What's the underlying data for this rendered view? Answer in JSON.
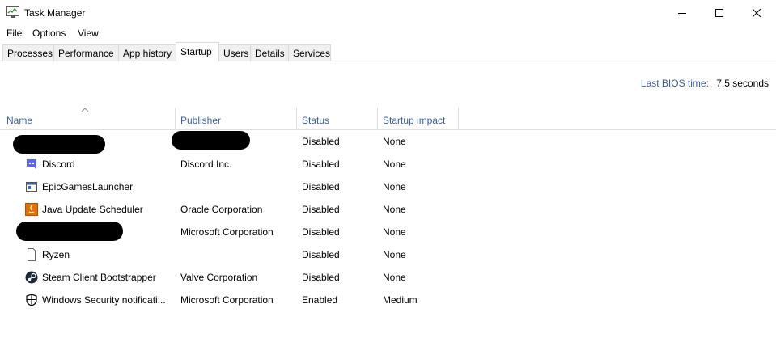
{
  "window": {
    "title": "Task Manager"
  },
  "menu": [
    "File",
    "Options",
    "View"
  ],
  "tabs": [
    "Processes",
    "Performance",
    "App history",
    "Startup",
    "Users",
    "Details",
    "Services"
  ],
  "active_tab": "Startup",
  "bios": {
    "label": "Last BIOS time:",
    "value": "7.5 seconds"
  },
  "columns": {
    "name": "Name",
    "publisher": "Publisher",
    "status": "Status",
    "impact": "Startup impact"
  },
  "rows": [
    {
      "name": "",
      "publisher": "",
      "status": "Disabled",
      "impact": "None",
      "icon": "redacted"
    },
    {
      "name": "Discord",
      "publisher": "Discord Inc.",
      "status": "Disabled",
      "impact": "None",
      "icon": "discord-icon"
    },
    {
      "name": "EpicGamesLauncher",
      "publisher": "",
      "status": "Disabled",
      "impact": "None",
      "icon": "window-app-icon"
    },
    {
      "name": "Java Update Scheduler",
      "publisher": "Oracle Corporation",
      "status": "Disabled",
      "impact": "None",
      "icon": "java-icon"
    },
    {
      "name": "",
      "publisher": "Microsoft Corporation",
      "status": "Disabled",
      "impact": "None",
      "icon": "redacted"
    },
    {
      "name": "Ryzen",
      "publisher": "",
      "status": "Disabled",
      "impact": "None",
      "icon": "blank-file-icon"
    },
    {
      "name": "Steam Client Bootstrapper",
      "publisher": "Valve Corporation",
      "status": "Disabled",
      "impact": "None",
      "icon": "steam-icon"
    },
    {
      "name": "Windows Security notificati...",
      "publisher": "Microsoft Corporation",
      "status": "Enabled",
      "impact": "Medium",
      "icon": "shield-icon"
    }
  ],
  "colors": {
    "header_text": "#3b5fa0",
    "java": "#e76f00"
  }
}
